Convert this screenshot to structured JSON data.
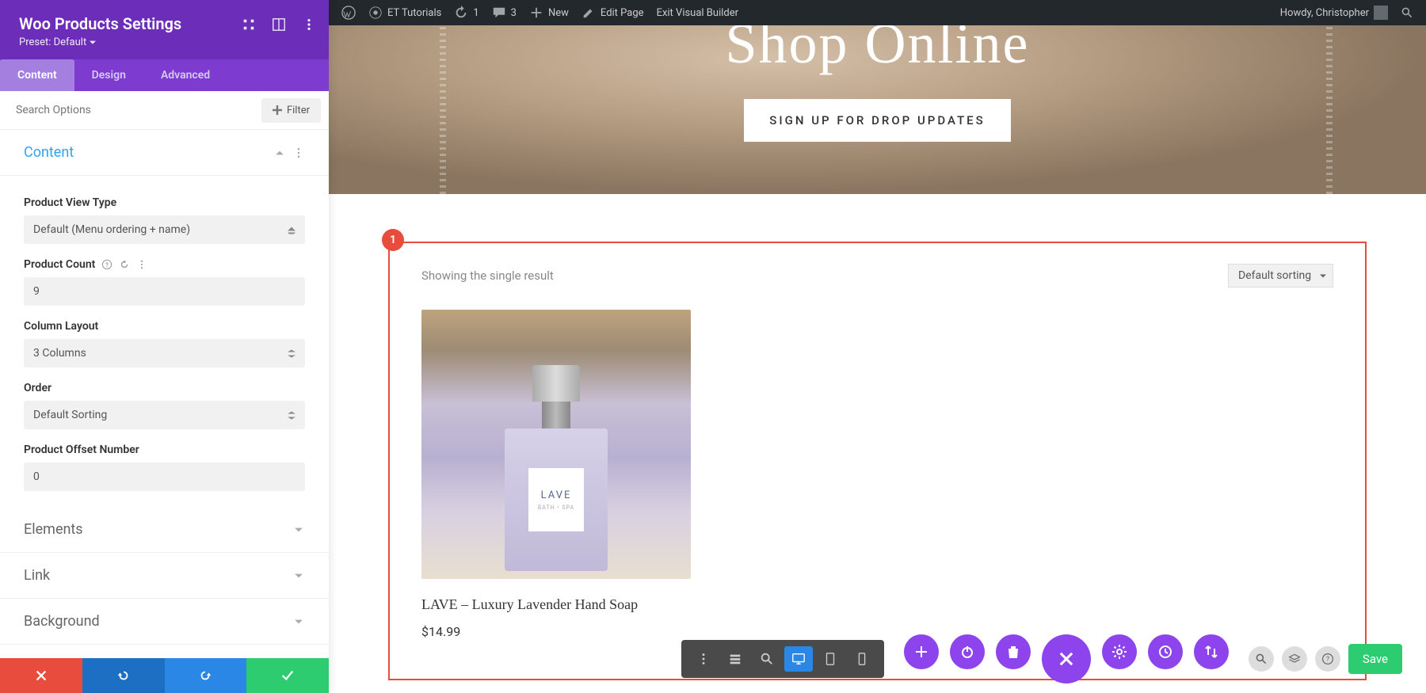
{
  "adminbar": {
    "site": "ET Tutorials",
    "updates": "1",
    "comments": "3",
    "new": "New",
    "edit": "Edit Page",
    "exit": "Exit Visual Builder",
    "howdy": "Howdy, Christopher"
  },
  "sidebar": {
    "title": "Woo Products Settings",
    "preset": "Preset: Default",
    "tabs": {
      "content": "Content",
      "design": "Design",
      "advanced": "Advanced"
    },
    "search_placeholder": "Search Options",
    "filter": "Filter",
    "sections": {
      "content": {
        "title": "Content",
        "product_view_type": {
          "label": "Product View Type",
          "value": "Default (Menu ordering + name)"
        },
        "product_count": {
          "label": "Product Count",
          "value": "9"
        },
        "column_layout": {
          "label": "Column Layout",
          "value": "3 Columns"
        },
        "order": {
          "label": "Order",
          "value": "Default Sorting"
        },
        "offset": {
          "label": "Product Offset Number",
          "value": "0"
        }
      },
      "elements": {
        "title": "Elements"
      },
      "link": {
        "title": "Link"
      },
      "background": {
        "title": "Background"
      }
    }
  },
  "hero": {
    "title": "Shop Online",
    "button": "SIGN UP FOR DROP UPDATES"
  },
  "module": {
    "badge": "1",
    "result_text": "Showing the single result",
    "sort": "Default sorting",
    "product": {
      "brand": "LAVE",
      "subtitle": "BATH • SPA",
      "title": "LAVE – Luxury Lavender Hand Soap",
      "price": "$14.99"
    }
  },
  "builder": {
    "save": "Save"
  }
}
